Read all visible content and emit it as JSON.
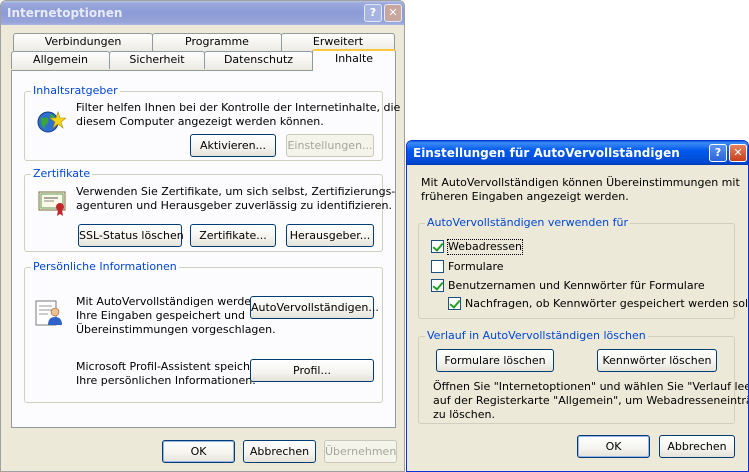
{
  "internet_options": {
    "title": "Internetoptionen",
    "help_glyph": "?",
    "close_glyph": "✕",
    "tabs_back": [
      "Verbindungen",
      "Programme",
      "Erweitert"
    ],
    "tabs_front": [
      "Allgemein",
      "Sicherheit",
      "Datenschutz",
      "Inhalte"
    ],
    "selected_tab": "Inhalte",
    "content_advisor": {
      "title": "Inhaltsratgeber",
      "text_line1": "Filter helfen Ihnen bei der Kontrolle der Internetinhalte, die auf",
      "text_line2": "diesem Computer angezeigt werden können.",
      "activate_label": "Aktivieren...",
      "settings_label": "Einstellungen..."
    },
    "certificates": {
      "title": "Zertifikate",
      "text_line1": "Verwenden Sie Zertifikate, um sich selbst, Zertifizierungs-",
      "text_line2": "agenturen und Herausgeber zuverlässig zu identifizieren.",
      "ssl_label": "SSL-Status löschen",
      "certs_label": "Zertifikate...",
      "publishers_label": "Herausgeber..."
    },
    "personal": {
      "title": "Persönliche Informationen",
      "autocomplete_line1": "Mit AutoVervollständigen werden",
      "autocomplete_line2": "Ihre Eingaben gespeichert und",
      "autocomplete_line3": "Übereinstimmungen vorgeschlagen.",
      "autocomplete_label": "AutoVervollständigen...",
      "profile_line1": "Microsoft Profil-Assistent speichert",
      "profile_line2": "Ihre persönlichen Informationen.",
      "profile_label": "Profil..."
    },
    "ok_label": "OK",
    "cancel_label": "Abbrechen",
    "apply_label": "Übernehmen"
  },
  "autocomplete_dialog": {
    "title": "Einstellungen für AutoVervollständigen",
    "help_glyph": "?",
    "close_glyph": "✕",
    "intro_line1": "Mit AutoVervollständigen können Übereinstimmungen mit",
    "intro_line2": "früheren Eingaben angezeigt werden.",
    "use_for": {
      "title": "AutoVervollständigen verwenden für",
      "web_addresses": {
        "label": "Webadressen",
        "checked": true
      },
      "forms": {
        "label": "Formulare",
        "checked": false
      },
      "usernames": {
        "label": "Benutzernamen und Kennwörter für Formulare",
        "checked": true
      },
      "prompt": {
        "label": "Nachfragen, ob Kennwörter gespeichert werden sollen",
        "checked": true
      }
    },
    "clear_history": {
      "title": "Verlauf in AutoVervollständigen löschen",
      "clear_forms_label": "Formulare löschen",
      "clear_passwords_label": "Kennwörter löschen",
      "note_line1": "Öffnen Sie \"Internetoptionen\" und wählen Sie \"Verlauf leeren\"",
      "note_line2": "auf der Registerkarte \"Allgemein\", um Webadresseneinträge",
      "note_line3": "zu löschen."
    },
    "ok_label": "OK",
    "cancel_label": "Abbrechen"
  },
  "colors": {
    "xp_blue": "#0054e3",
    "group_title": "#0046d5",
    "pointer_arrow": "#d9362b"
  }
}
